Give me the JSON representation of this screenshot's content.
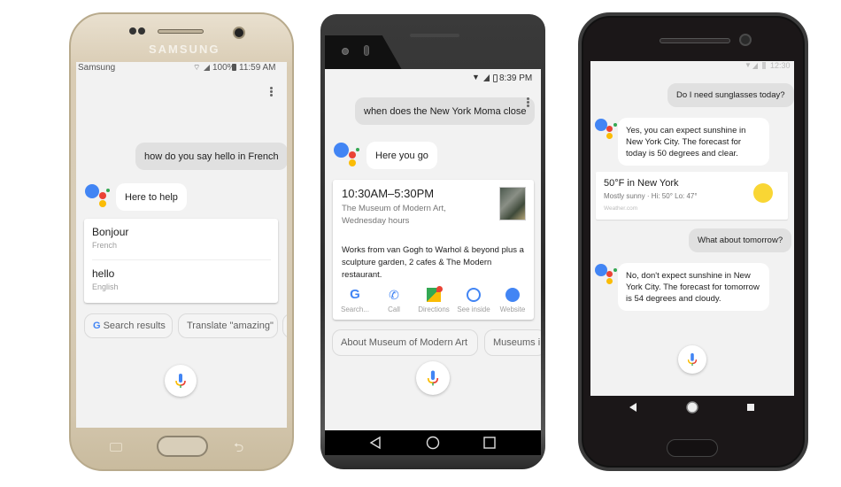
{
  "phones": [
    {
      "brand": "SAMSUNG",
      "status": {
        "carrier": "Samsung",
        "battery": "100%",
        "time": "11:59 AM"
      },
      "conversation": {
        "user_query": "how do you say hello in French",
        "assistant_reply": "Here to help"
      },
      "translation_card": {
        "rows": [
          {
            "word": "Bonjour",
            "language": "French"
          },
          {
            "word": "hello",
            "language": "English"
          }
        ]
      },
      "suggestion_chips": [
        "Search results",
        "Translate \"amazing\""
      ]
    },
    {
      "status": {
        "time": "8:39 PM"
      },
      "conversation": {
        "user_query": "when does the New York Moma close",
        "assistant_reply": "Here you go"
      },
      "hours_card": {
        "hours": "10:30AM–5:30PM",
        "place": "The Museum of Modern Art,",
        "day": "Wednesday hours",
        "description": "Works from van Gogh to Warhol & beyond plus a sculpture garden, 2 cafes & The Modern restaurant.",
        "actions": [
          {
            "label": "Search...",
            "icon": "google-g-icon"
          },
          {
            "label": "Call",
            "icon": "phone-icon"
          },
          {
            "label": "Directions",
            "icon": "maps-icon"
          },
          {
            "label": "See inside",
            "icon": "street-view-icon"
          },
          {
            "label": "Website",
            "icon": "globe-icon"
          }
        ]
      },
      "suggestion_chips": [
        "About Museum of Modern Art",
        "Museums i"
      ]
    },
    {
      "status": {
        "time": "12:30"
      },
      "conversation": [
        {
          "role": "user",
          "text": "Do I need sunglasses today?"
        },
        {
          "role": "assistant",
          "text": "Yes, you can expect sunshine in New York City. The forecast for today is 50 degrees and clear."
        },
        {
          "role": "user",
          "text": "What about tomorrow?"
        },
        {
          "role": "assistant",
          "text": "No, don't expect sunshine in New York City. The forecast for tomorrow is 54 degrees and cloudy."
        }
      ],
      "weather_card": {
        "title": "50°F in New York",
        "details": "Mostly sunny · Hi: 50° Lo: 47°",
        "source": "Weather.com"
      }
    }
  ],
  "colors": {
    "google_blue": "#4285f4",
    "google_red": "#ea4335",
    "google_yellow": "#fbbc05",
    "google_green": "#34a853",
    "sun_yellow": "#f9d634"
  }
}
